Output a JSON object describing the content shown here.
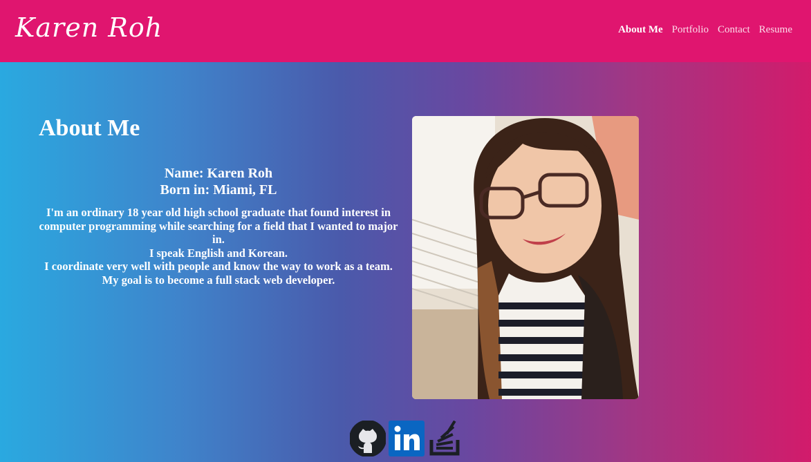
{
  "header": {
    "brand": "Karen Roh",
    "nav": [
      "About Me",
      "Portfolio",
      "Contact",
      "Resume"
    ],
    "active": "About Me"
  },
  "about": {
    "heading": "About Me",
    "name": "Name: Karen Roh",
    "born": "Born in: Miami, FL",
    "bio": [
      "I'm an ordinary 18 year old high school graduate that found interest in computer programming while searching for a field that I wanted to major in.",
      "I speak English and Korean.",
      "I coordinate very well with people and know the way to work as a team.",
      "My goal is to become a full stack web developer."
    ]
  },
  "social": [
    {
      "icon": "github-icon"
    },
    {
      "icon": "linkedin-icon"
    },
    {
      "icon": "stackoverflow-icon"
    }
  ],
  "colors": {
    "header": "#e0156f",
    "gradient_left": "#2aa9e0",
    "gradient_mid": "#4a5aab",
    "gradient_right": "#d21b6b"
  }
}
